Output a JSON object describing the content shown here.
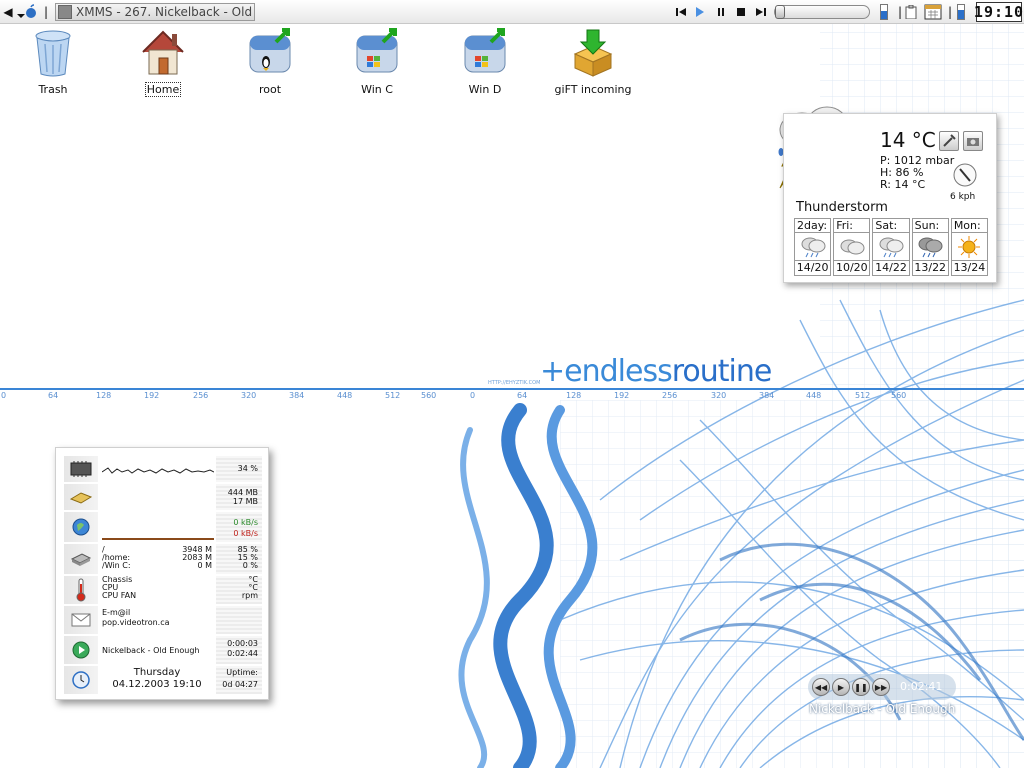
{
  "panel": {
    "task_title": "XMMS - 267. Nickelback - Old Enough",
    "clock": "19:10",
    "volume_level": 0.55,
    "meter_level": 0.65
  },
  "desktop_icons": [
    {
      "label": "Trash",
      "icon": "trash-icon"
    },
    {
      "label": "Home",
      "icon": "home-icon"
    },
    {
      "label": "root",
      "icon": "drive-linux-icon"
    },
    {
      "label": "Win C",
      "icon": "drive-windows-icon"
    },
    {
      "label": "Win D",
      "icon": "drive-windows-icon"
    },
    {
      "label": "giFT incoming",
      "icon": "box-download-icon"
    }
  ],
  "weather": {
    "temp": "14 °C",
    "pressure": "P: 1012 mbar",
    "humidity": "H: 86 %",
    "realfeel": "R: 14 °C",
    "wind": "6 kph",
    "condition": "Thunderstorm",
    "forecast": [
      {
        "day": "2day:",
        "temps": "14/20",
        "icon": "rain-icon"
      },
      {
        "day": "Fri:",
        "temps": "10/20",
        "icon": "cloud-icon"
      },
      {
        "day": "Sat:",
        "temps": "14/22",
        "icon": "rain-icon"
      },
      {
        "day": "Sun:",
        "temps": "13/22",
        "icon": "storm-icon"
      },
      {
        "day": "Mon:",
        "temps": "13/24",
        "icon": "sun-icon"
      }
    ]
  },
  "sysmon": {
    "cpu": "34 %",
    "mem_used": "444 MB",
    "swap_used": "17 MB",
    "net_down": "0 kB/s",
    "net_up": "0 kB/s",
    "disks": [
      {
        "mount": "/",
        "size": "3948 M",
        "pct": "85 %"
      },
      {
        "mount": "/home:",
        "size": "2083 M",
        "pct": "15 %"
      },
      {
        "mount": "/Win C:",
        "size": "0 M",
        "pct": "0 %"
      }
    ],
    "sensors": [
      {
        "label": "Chassis",
        "unit": "°C"
      },
      {
        "label": "CPU",
        "unit": "°C"
      },
      {
        "label": "CPU FAN",
        "unit": "rpm"
      }
    ],
    "mail_label": "E-m@il",
    "mail_server": "pop.videotron.ca",
    "track": "Nickelback - Old Enough",
    "track_elapsed": "0:00:03",
    "track_total": "0:02:44",
    "day": "Thursday",
    "datetime": "04.12.2003 19:10",
    "uptime_label": "Uptime:",
    "uptime": "0d 04:27"
  },
  "logo": {
    "plus": "+",
    "text_a": "endless",
    "text_b": "routine",
    "url": "HTTP://EHYZTIK.COM"
  },
  "ruler_ticks": [
    "0",
    "64",
    "128",
    "192",
    "256",
    "320",
    "384",
    "448",
    "512",
    "560",
    "0",
    "64",
    "128",
    "192",
    "256",
    "320",
    "384",
    "448",
    "512",
    "560"
  ],
  "player": {
    "time": "0:02:41",
    "song": "Nickelback - Old Enough"
  }
}
